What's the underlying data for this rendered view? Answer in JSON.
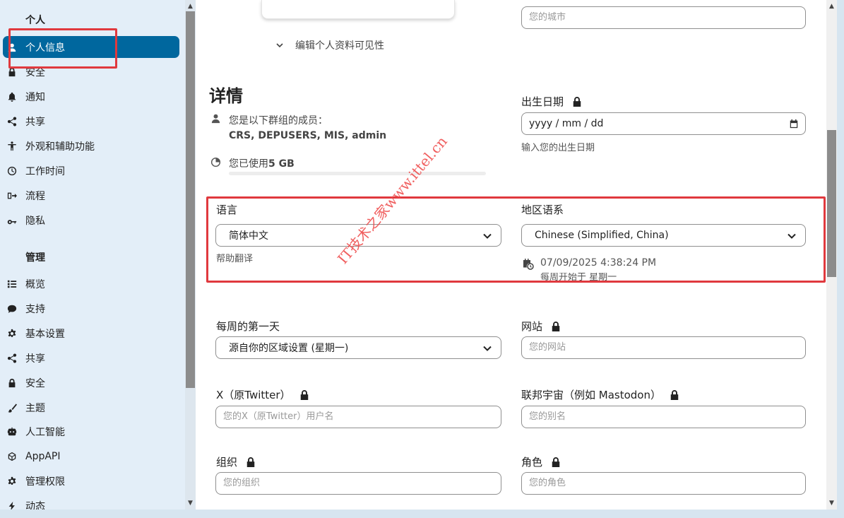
{
  "sidebar": {
    "personal_heading": "个人",
    "admin_heading": "管理",
    "personal_items": [
      {
        "label": "个人信息",
        "icon": "person-icon",
        "active": true
      },
      {
        "label": "安全",
        "icon": "lock-icon"
      },
      {
        "label": "通知",
        "icon": "bell-icon"
      },
      {
        "label": "共享",
        "icon": "share-icon"
      },
      {
        "label": "外观和辅助功能",
        "icon": "accessibility-icon"
      },
      {
        "label": "工作时间",
        "icon": "clock-icon"
      },
      {
        "label": "流程",
        "icon": "flow-icon"
      },
      {
        "label": "隐私",
        "icon": "key-icon"
      }
    ],
    "admin_items": [
      {
        "label": "概览",
        "icon": "list-icon"
      },
      {
        "label": "支持",
        "icon": "chat-icon"
      },
      {
        "label": "基本设置",
        "icon": "gear-icon"
      },
      {
        "label": "共享",
        "icon": "share-icon"
      },
      {
        "label": "安全",
        "icon": "lock-icon"
      },
      {
        "label": "主题",
        "icon": "brush-icon"
      },
      {
        "label": "人工智能",
        "icon": "robot-icon"
      },
      {
        "label": "AppAPI",
        "icon": "cube-icon"
      },
      {
        "label": "管理权限",
        "icon": "gear-icon"
      },
      {
        "label": "动态",
        "icon": "bolt-icon"
      }
    ]
  },
  "main": {
    "city_placeholder": "您的城市",
    "edit_visibility": "编辑个人资料可见性",
    "details_title": "详情",
    "groups_label": "您是以下群组的成员：",
    "groups_value": "CRS, DEPUSERS, MIS, admin",
    "usage_prefix": "您已使用",
    "usage_value": "5 GB",
    "usage_fraction": 0.0,
    "birthday_label": "出生日期",
    "birthday_value": "yyyy / mm / dd",
    "birthday_hint": "输入您的出生日期",
    "language_label": "语言",
    "language_value": "简体中文",
    "language_hint": "帮助翻译",
    "locale_label": "地区语系",
    "locale_value": "Chinese (Simplified, China)",
    "locale_time": "07/09/2025 4:38:24 PM",
    "locale_week": "每周开始于 星期一",
    "first_day_label": "每周的第一天",
    "first_day_value": "源自你的区域设置 (星期一)",
    "website_label": "网站",
    "website_placeholder": "您的网站",
    "twitter_label": "X（原Twitter）",
    "twitter_placeholder": "您的X（原Twitter）用户名",
    "fediverse_label": "联邦宇宙（例如 Mastodon）",
    "fediverse_placeholder": "您的别名",
    "org_label": "组织",
    "org_placeholder": "您的组织",
    "role_label": "角色",
    "role_placeholder": "您的角色"
  },
  "watermark": "IT技术之家www.ittel.cn",
  "colors": {
    "accent": "#00679e",
    "highlight": "#e0393e"
  }
}
